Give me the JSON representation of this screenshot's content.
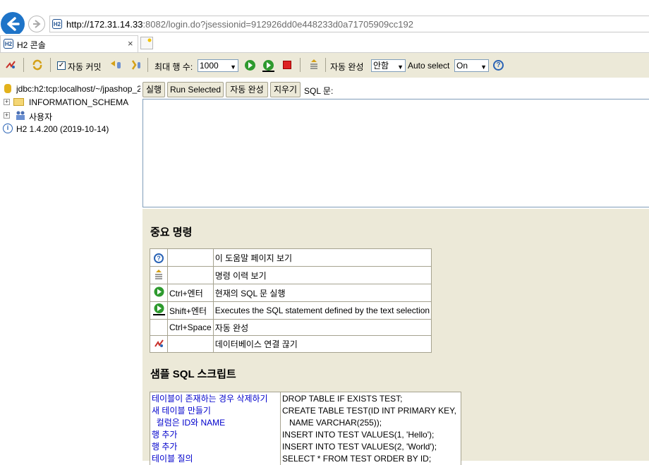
{
  "browser": {
    "url_host": "http://172.31.14.33",
    "url_rest": ":8082/login.do?jsessionid=912926dd0e448233d0a71705909cc192",
    "tab_title": "H2 콘솔",
    "tab_close": "×",
    "logo_text": "H2"
  },
  "toolbar": {
    "autocommit_label": "자동 커밋",
    "autocommit_checked": "✓",
    "maxrows_label": "최대 행 수:",
    "maxrows_value": "1000",
    "autocomplete_label": "자동 완성",
    "autocomplete_value": "안함",
    "autoselect_label": "Auto select",
    "autoselect_value": "On",
    "help_icon_text": "?"
  },
  "tree": {
    "connection": "jdbc:h2:tcp:localhost/~/jpashop_2",
    "schema": "INFORMATION_SCHEMA",
    "users": "사용자",
    "version": "H2 1.4.200 (2019-10-14)"
  },
  "sql_toolbar": {
    "run": "실행",
    "run_selected": "Run Selected",
    "autocomplete": "자동 완성",
    "clear": "지우기",
    "sql_label": "SQL 문:"
  },
  "help": {
    "title_important": "중요 명령",
    "commands": [
      {
        "key": "",
        "desc": "이 도움말 페이지 보기"
      },
      {
        "key": "",
        "desc": "명령 이력 보기"
      },
      {
        "key": "Ctrl+엔터",
        "desc": "현재의 SQL 문 실행"
      },
      {
        "key": "Shift+엔터",
        "desc": "Executes the SQL statement defined by the text selection"
      },
      {
        "key": "Ctrl+Space",
        "desc": "자동 완성"
      },
      {
        "key": "",
        "desc": "데이터베이스 연결 끊기"
      }
    ],
    "title_sample": "샘플 SQL 스크립트",
    "samples": [
      {
        "label": "테이블이 존재하는 경우 삭제하기",
        "sql": "DROP TABLE IF EXISTS TEST;"
      },
      {
        "label": "새 테이블 만들기",
        "sql": "CREATE TABLE TEST(ID INT PRIMARY KEY,"
      },
      {
        "label": "  컬럼은 ID와 NAME",
        "sql": "   NAME VARCHAR(255));"
      },
      {
        "label": "행 추가",
        "sql": "INSERT INTO TEST VALUES(1, 'Hello');"
      },
      {
        "label": "행 추가",
        "sql": "INSERT INTO TEST VALUES(2, 'World');"
      },
      {
        "label": "테이블 질의",
        "sql": "SELECT * FROM TEST ORDER BY ID;"
      }
    ]
  }
}
